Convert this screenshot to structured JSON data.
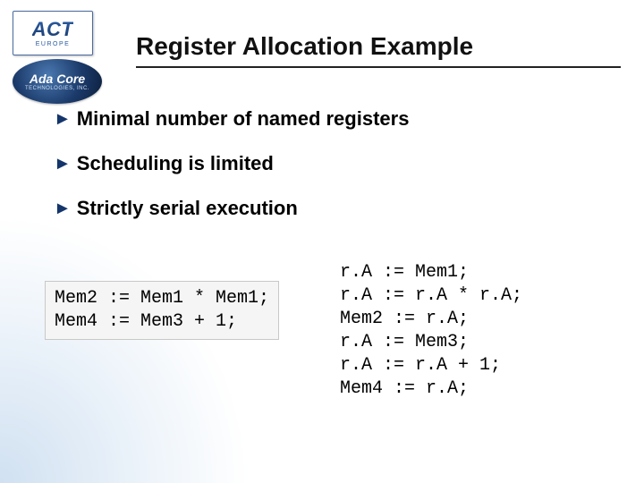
{
  "logo": {
    "act_text": "ACT",
    "act_sub": "EUROPE",
    "adacore_main": "Ada Core",
    "adacore_sub": "TECHNOLOGIES, INC."
  },
  "title": "Register Allocation Example",
  "bullets": [
    "Minimal number of named registers",
    "Scheduling is limited",
    "Strictly serial execution"
  ],
  "code_left": "Mem2 := Mem1 * Mem1;\nMem4 := Mem3 + 1;",
  "code_right": "r.A := Mem1;\nr.A := r.A * r.A;\nMem2 := r.A;\nr.A := Mem3;\nr.A := r.A + 1;\nMem4 := r.A;"
}
